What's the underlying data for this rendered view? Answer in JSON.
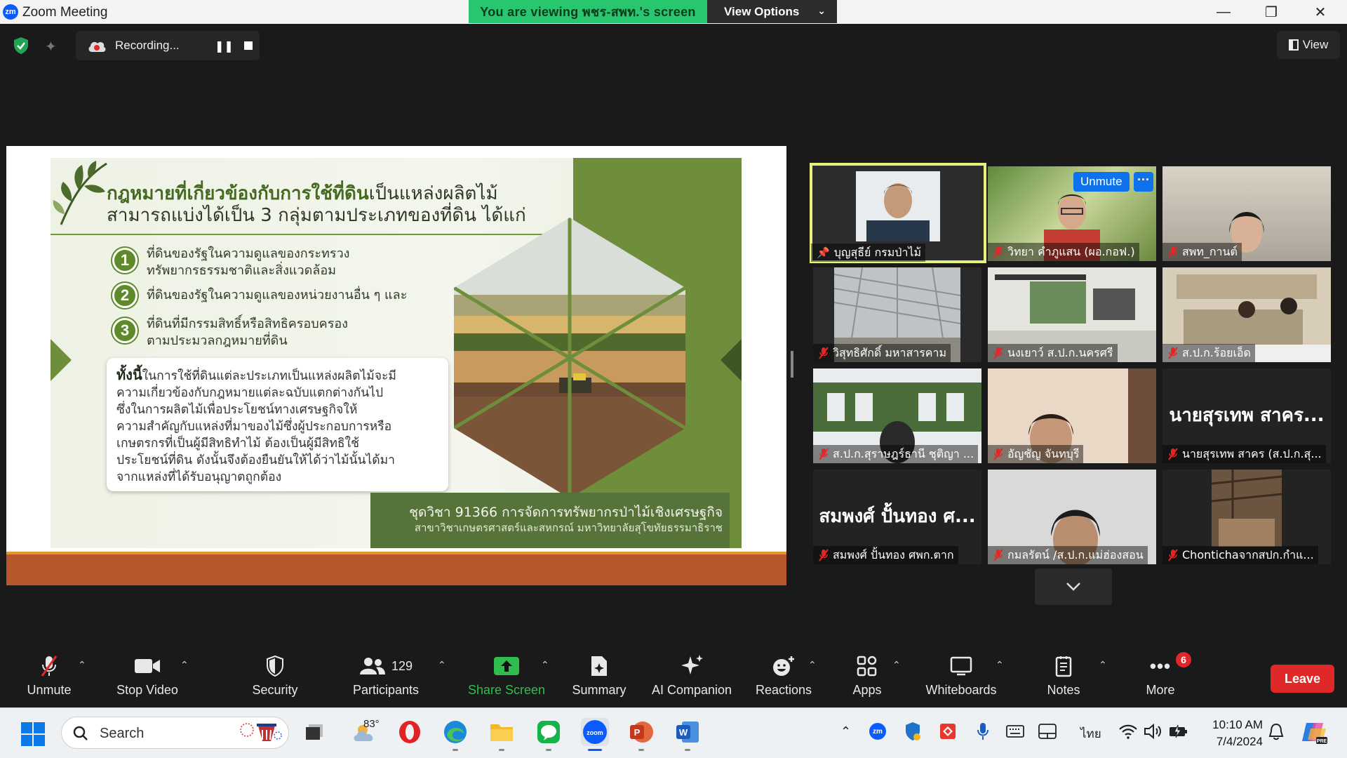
{
  "window": {
    "title": "Zoom Meeting",
    "logo_text": "zm",
    "viewing_banner": "You are viewing พชร-สพท.'s screen",
    "view_options_label": "View Options"
  },
  "top_bar": {
    "recording_label": "Recording...",
    "view_label": "View"
  },
  "slide": {
    "title_part1": "กฎหมายที่เกี่ยวข้องกับการใช้ที่ดิน",
    "title_part2": "เป็นแหล่งผลิตไม้",
    "title_line2": "สามารถแบ่งได้เป็น 3 กลุ่มตามประเภทของที่ดิน ได้แก่",
    "items": [
      {
        "num": "1",
        "line1": "ที่ดินของรัฐในความดูแลของกระทรวง",
        "line2": "ทรัพยากรธรรมชาติและสิ่งแวดล้อม"
      },
      {
        "num": "2",
        "line1": "ที่ดินของรัฐในความดูแลของหน่วยงานอื่น ๆ และ",
        "line2": ""
      },
      {
        "num": "3",
        "line1": "ที่ดินที่มีกรรมสิทธิ์หรือสิทธิครอบครอง",
        "line2": "ตามประมวลกฎหมายที่ดิน"
      }
    ],
    "note_lead": "ทั้งนี้",
    "note_lines": [
      "ในการใช้ที่ดินแต่ละประเภทเป็นแหล่งผลิตไม้จะมี",
      "ความเกี่ยวข้องกับกฎหมายแต่ละฉบับแตกต่างกันไป",
      "ซึ่งในการผลิตไม้เพื่อประโยชน์ทางเศรษฐกิจให้",
      "ความสำคัญกับแหล่งที่มาของไม้ซึ่งผู้ประกอบการหรือ",
      "เกษตรกรที่เป็นผู้มีสิทธิทำไม้ ต้องเป็นผู้มีสิทธิใช้",
      "ประโยชน์ที่ดิน ดังนั้นจึงต้องยืนยันให้ได้ว่าไม้นั้นได้มา",
      "จากแหล่งที่ได้รับอนุญาตถูกต้อง"
    ],
    "footer_line1": "ชุดวิชา 91366 การจัดการทรัพยากรป่าไม้เชิงเศรษฐกิจ",
    "footer_line2": "สาขาวิชาเกษตรศาสตร์และสหกรณ์ มหาวิทยาลัยสุโขทัยธรรมาธิราช"
  },
  "participants_grid": [
    {
      "name": "บุญสุธีย์ กรมป่าไม้",
      "type": "video",
      "muted": false,
      "pinned": true,
      "active": true
    },
    {
      "name": "วิทยา คำภูแสน (ผอ.กอฟ.)",
      "type": "video",
      "muted": true,
      "unmute_chip": "Unmute",
      "more_chip": "···"
    },
    {
      "name": "สพท_กานต์",
      "type": "video",
      "muted": true
    },
    {
      "name": "วิสุทธิศักดิ์ มหาสารคาม",
      "type": "video",
      "muted": true
    },
    {
      "name": "นงเยาว์ ส.ป.ก.นครศรี",
      "type": "video",
      "muted": true
    },
    {
      "name": "ส.ป.ก.ร้อยเอ็ด",
      "type": "video",
      "muted": true
    },
    {
      "name": "ส.ป.ก.สุราษฎร์ธานี ชุติญา ...",
      "type": "video",
      "muted": true
    },
    {
      "name": "อัญชัญ จันทบุรี",
      "type": "video",
      "muted": true
    },
    {
      "name": "นายสุรเทพ สาคร (ส.ป.ก.สุ...",
      "type": "name",
      "big_name": "นายสุรเทพ สาคร...",
      "muted": true
    },
    {
      "name": "สมพงศ์ ปั้นทอง ศพก.ตาก",
      "type": "name",
      "big_name": "สมพงศ์ ปั้นทอง ศ...",
      "muted": true
    },
    {
      "name": "กมลรัตน์ /ส.ป.ก.แม่ฮ่องสอน",
      "type": "video",
      "muted": true
    },
    {
      "name": "Chontichaจากสปก.กำแ...",
      "type": "video",
      "muted": true
    }
  ],
  "toolbar": {
    "unmute": "Unmute",
    "stop_video": "Stop Video",
    "security": "Security",
    "participants": "Participants",
    "participants_count": "129",
    "share_screen": "Share Screen",
    "summary": "Summary",
    "ai_companion": "AI Companion",
    "reactions": "Reactions",
    "apps": "Apps",
    "whiteboards": "Whiteboards",
    "notes": "Notes",
    "more": "More",
    "more_badge": "6",
    "leave": "Leave"
  },
  "taskbar": {
    "search_placeholder": "Search",
    "weather_temp": "83°",
    "language": "ไทย",
    "time": "10:10 AM",
    "date": "7/4/2024",
    "zoom_tray_label": "zm"
  },
  "colors": {
    "zoom_blue": "#0b5cff",
    "banner_green": "#28c76f",
    "leave_red": "#e02828",
    "active_speaker": "#e7f07d",
    "share_green": "#2fbd4d"
  }
}
